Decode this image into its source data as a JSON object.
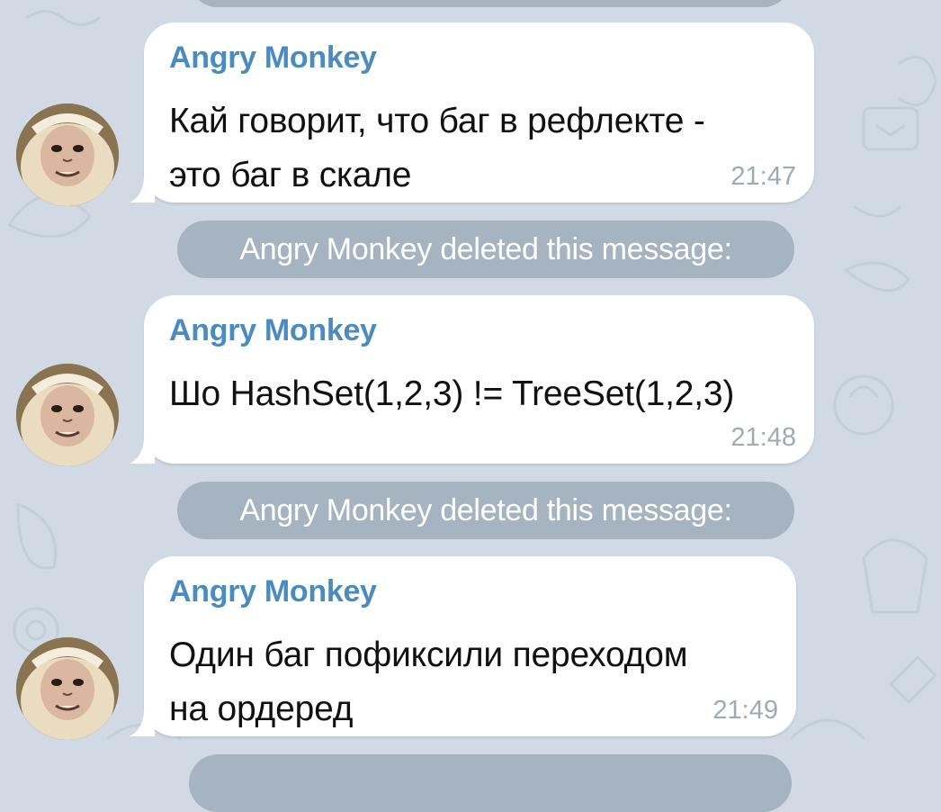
{
  "messages": [
    {
      "sender": "Angry Monkey",
      "lines": [
        "Кай говорит, что баг в рефлекте -",
        "это баг в скале"
      ],
      "time": "21:47"
    },
    {
      "sender": "Angry Monkey",
      "lines": [
        "Шо HashSet(1,2,3) != TreeSet(1,2,3)"
      ],
      "time": "21:48"
    },
    {
      "sender": "Angry Monkey",
      "lines": [
        "Один баг пофиксили переходом",
        "на ордеред"
      ],
      "time": "21:49"
    }
  ],
  "service_messages": [
    "Angry Monkey deleted this message:",
    "Angry Monkey deleted this message:"
  ],
  "colors": {
    "background": "#d1dae4",
    "sender_name": "#4a8bc0",
    "bubble": "#ffffff",
    "service_pill": "#9aa8b6",
    "timestamp": "#a1aab3"
  },
  "icons": [
    "monkey-avatar"
  ]
}
